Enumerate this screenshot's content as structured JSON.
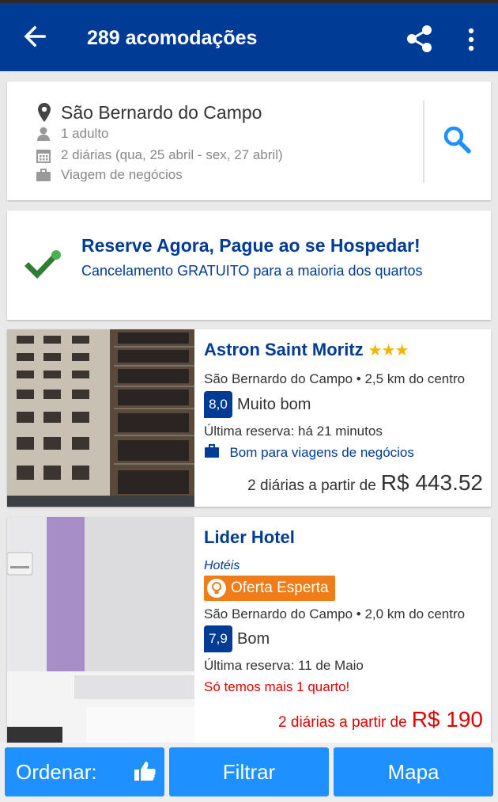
{
  "header": {
    "title": "289 acomodações",
    "background": "#003b95",
    "icons": [
      "back-arrow-icon",
      "share-icon",
      "more-vert-icon"
    ]
  },
  "search": {
    "destination": "São Bernardo do Campo",
    "guests": "1 adulto",
    "dates": "2 diárias (qua, 25 abril - sex, 27 abril)",
    "trip_type": "Viagem de negócios",
    "icons": [
      "location-pin-icon",
      "person-icon",
      "calendar-icon",
      "briefcase-icon",
      "search-icon"
    ]
  },
  "promo": {
    "headline": "Reserve Agora, Pague ao se Hospedar!",
    "subtext": "Cancelamento GRATUITO para a maioria dos quartos"
  },
  "hotels": [
    {
      "name": "Astron Saint Moritz",
      "stars": "★★★",
      "location": "São Bernardo do Campo • 2,5 km do centro",
      "score": "8,0",
      "score_word": "Muito bom",
      "last_booking": "Última reserva: há 21 minutos",
      "feature": "Bom para viagens de negócios",
      "price_label": "2 diárias a partir de",
      "price": "R$ 443.52"
    },
    {
      "name": "Lider Hotel",
      "category": "Hotéis",
      "badge": "Oferta Esperta",
      "location": "São Bernardo do Campo • 2,0 km do centro",
      "score": "7,9",
      "score_word": "Bom",
      "last_booking": "Última reserva: 11 de Maio",
      "scarcity": "Só temos mais 1 quarto!",
      "price_label": "2 diárias a partir de",
      "price": "R$ 190"
    }
  ],
  "bottom_bar": {
    "sort_label": "Ordenar:",
    "filter_label": "Filtrar",
    "map_label": "Mapa",
    "accent": "#1e90ff"
  }
}
